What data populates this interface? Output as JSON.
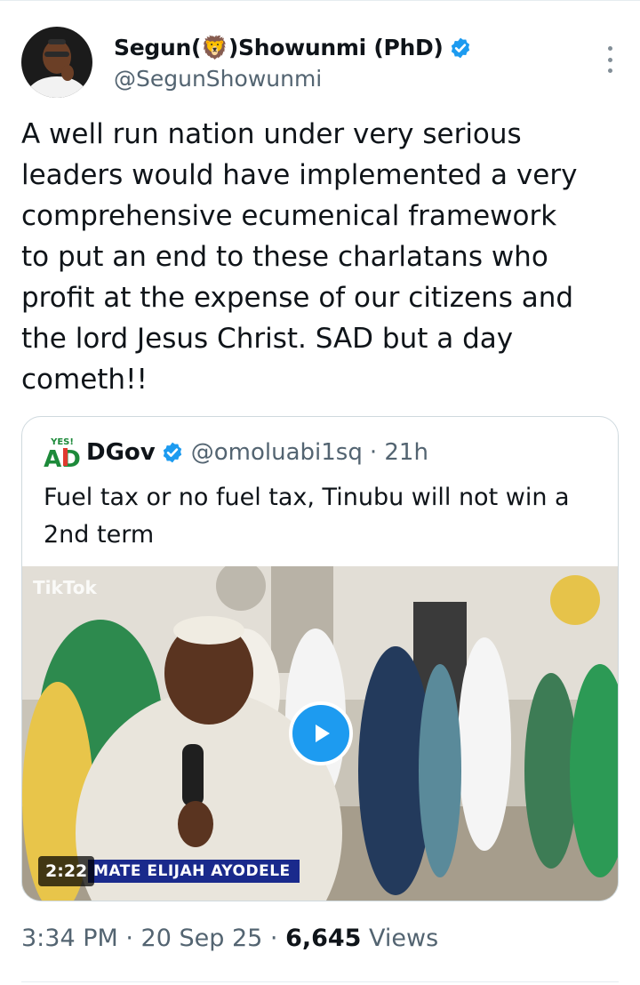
{
  "author": {
    "display_name": "Segun(🦁)Showunmi (PhD)",
    "handle": "@SegunShowunmi"
  },
  "tweet": {
    "text": "A well run nation under very serious\nleaders would have implemented a very\ncomprehensive ecumenical framework\nto put an end to these charlatans who\nprofit at the expense of our citizens and\nthe lord Jesus Christ. SAD but a day\ncometh!!"
  },
  "quote": {
    "name": "DGov",
    "handle": "@omoluabi1sq",
    "time": "· 21h",
    "text": "Fuel tax or no fuel tax, Tinubu will not win a\n2nd term",
    "logo_text": "YES!",
    "logo_letters": "AD",
    "video": {
      "duration": "2:22",
      "caption": "MATE ELIJAH AYODELE",
      "watermark": "TikTok"
    }
  },
  "meta": {
    "time_date": "3:34 PM · 20 Sep 25 · ",
    "views_count": "6,645",
    "views_label": " Views"
  },
  "colors": {
    "accent": "#1d9bf0",
    "secondary_text": "#536471",
    "border": "#cfd9de"
  },
  "icons": {
    "verified": "verified-badge-icon",
    "more": "more-vertical-icon",
    "play": "play-icon"
  }
}
